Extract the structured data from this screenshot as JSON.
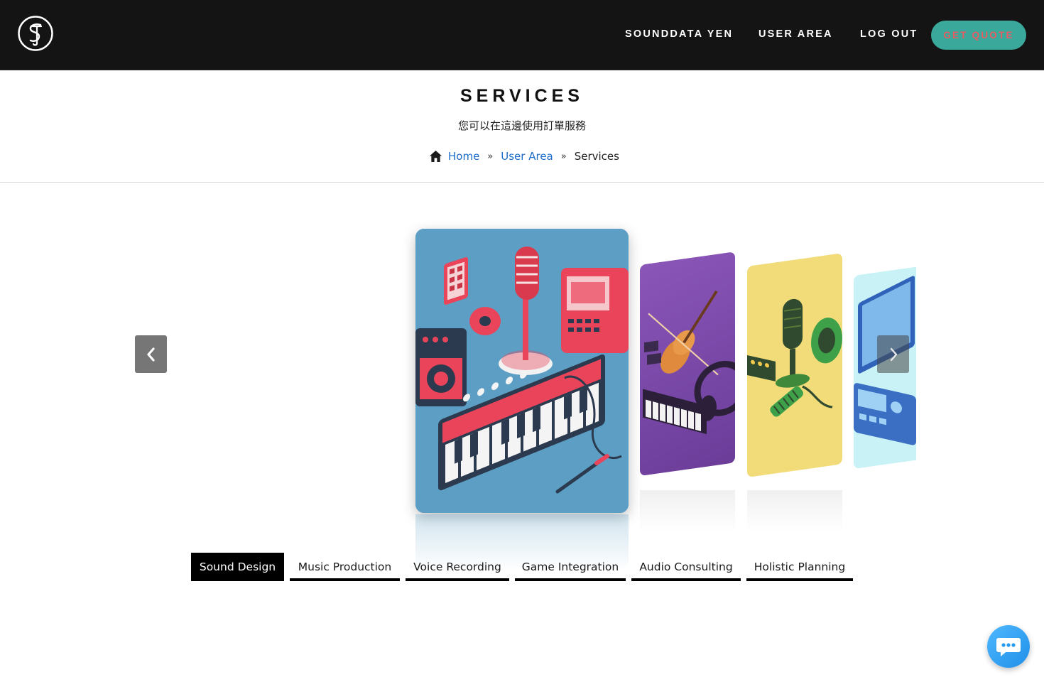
{
  "header": {
    "nav": [
      "SOUNDDATA YEN",
      "USER AREA",
      "LOG OUT"
    ],
    "quote_label": "GET QUOTE",
    "colors": {
      "bar": "#141414",
      "quote_bg": "#3aa99b",
      "quote_text": "#e95d62"
    }
  },
  "page": {
    "title": "SERVICES",
    "subtitle": "您可以在這邊使用訂單服務"
  },
  "breadcrumb": {
    "home_icon": "home-icon",
    "items": [
      "Home",
      "User Area",
      "Services"
    ],
    "separator": "»"
  },
  "carousel": {
    "prev_icon": "chevron-left-icon",
    "next_icon": "chevron-right-icon"
  },
  "tabs": {
    "items": [
      "Sound Design",
      "Music Production",
      "Voice Recording",
      "Game Integration",
      "Audio Consulting",
      "Holistic Planning"
    ],
    "active": "Sound Design"
  },
  "chat": {
    "icon": "chat-icon"
  }
}
